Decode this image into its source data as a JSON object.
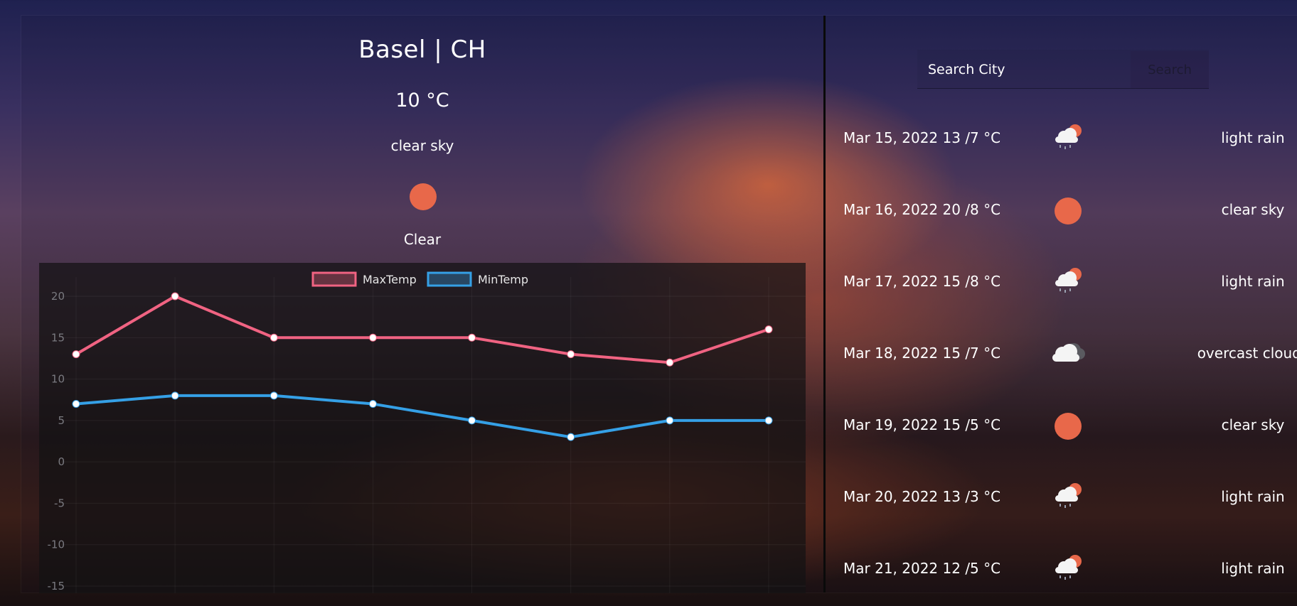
{
  "current": {
    "city": "Basel | CH",
    "temp": "10 °C",
    "description": "clear sky",
    "icon": "sun-icon",
    "main": "Clear"
  },
  "search": {
    "placeholder": "Search City",
    "button_label": "Search"
  },
  "forecast": [
    {
      "date": "Mar 15, 2022 13 /7 °C",
      "icon": "light-rain-icon",
      "description": "light rain"
    },
    {
      "date": "Mar 16, 2022 20 /8 °C",
      "icon": "sun-icon",
      "description": "clear sky"
    },
    {
      "date": "Mar 17, 2022 15 /8 °C",
      "icon": "light-rain-icon",
      "description": "light rain"
    },
    {
      "date": "Mar 18, 2022 15 /7 °C",
      "icon": "overcast-clouds-icon",
      "description": "overcast clouds"
    },
    {
      "date": "Mar 19, 2022 15 /5 °C",
      "icon": "sun-icon",
      "description": "clear sky"
    },
    {
      "date": "Mar 20, 2022 13 /3 °C",
      "icon": "light-rain-icon",
      "description": "light rain"
    },
    {
      "date": "Mar 21, 2022 12 /5 °C",
      "icon": "light-rain-icon",
      "description": "light rain"
    }
  ],
  "colors": {
    "max": "#f06382",
    "min": "#35a0e6",
    "sun": "#e8684a"
  },
  "chart_data": {
    "type": "line",
    "x": [
      1,
      2,
      3,
      4,
      5,
      6,
      7,
      8
    ],
    "series": [
      {
        "name": "MaxTemp",
        "values": [
          13,
          20,
          15,
          15,
          15,
          13,
          12,
          16
        ]
      },
      {
        "name": "MinTemp",
        "values": [
          7,
          8,
          8,
          7,
          5,
          3,
          5,
          5
        ]
      }
    ],
    "yticks": [
      20,
      15,
      10,
      5,
      0,
      -5,
      -10,
      -15
    ],
    "ylim": [
      -15,
      20
    ],
    "grid": true,
    "legend": "top-center"
  }
}
